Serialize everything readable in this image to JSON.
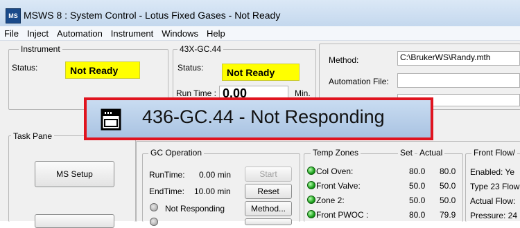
{
  "window": {
    "title": "MSWS 8 : System Control - Lotus Fixed Gases - Not Ready",
    "icon_text": "MS"
  },
  "menu": [
    "File",
    "Inject",
    "Automation",
    "Instrument",
    "Windows",
    "Help"
  ],
  "instrument": {
    "group_label": "Instrument",
    "status_label": "Status:",
    "status_value": "Not Ready"
  },
  "gc": {
    "group_label": "43X-GC.44",
    "status_label": "Status:",
    "status_value": "Not Ready",
    "runtime_label": "Run Time :",
    "runtime_value": "0.00",
    "runtime_unit": "Min."
  },
  "method_panel": {
    "method_label": "Method:",
    "method_value": "C:\\BrukerWS\\Randy.mth",
    "automation_label": "Automation File:",
    "automation_value": ""
  },
  "dialog_overlay": {
    "title": "436-GC.44 - Not Responding"
  },
  "task_pane": {
    "group_label": "Task Pane",
    "ms_setup_button": "MS Setup"
  },
  "gc_operation": {
    "group_label": "GC Operation",
    "runtime_label": "RunTime:",
    "runtime_value": "0.00 min",
    "endtime_label": "EndTime:",
    "endtime_value": "10.00 min",
    "state_text": "Not Responding",
    "start_button": "Start",
    "reset_button": "Reset",
    "method_button": "Method..."
  },
  "temp_zones": {
    "group_label": "Temp Zones",
    "headers": {
      "set": "Set",
      "actual": "Actual"
    },
    "rows": [
      {
        "name": "Col Oven:",
        "set": "80.0",
        "actual": "80.0"
      },
      {
        "name": "Front Valve:",
        "set": "50.0",
        "actual": "50.0"
      },
      {
        "name": "Zone 2:",
        "set": "50.0",
        "actual": "50.0"
      },
      {
        "name": "Front PWOC :",
        "set": "80.0",
        "actual": "79.9"
      }
    ]
  },
  "front_flow": {
    "group_label": "Front Flow/",
    "lines": [
      "Enabled: Ye",
      "Type 23 Flow",
      "Actual Flow:",
      "Pressure: 24"
    ]
  }
}
